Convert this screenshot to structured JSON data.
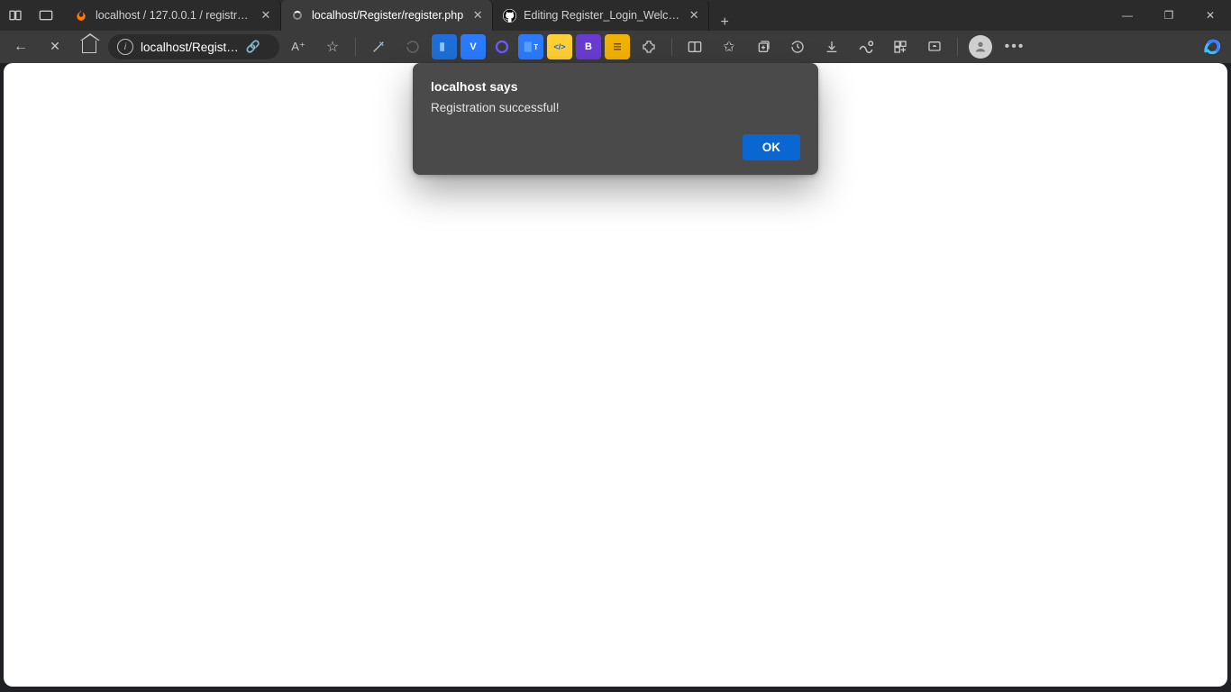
{
  "tabs": [
    {
      "title": "localhost / 127.0.0.1 / registratio",
      "favicon": "flame-icon"
    },
    {
      "title": "localhost/Register/register.php",
      "favicon": "loading-icon"
    },
    {
      "title": "Editing Register_Login_Welcome",
      "favicon": "github-icon"
    }
  ],
  "addressbar": {
    "url": "localhost/Regist…"
  },
  "dialog": {
    "title": "localhost says",
    "message": "Registration successful!",
    "ok_label": "OK"
  },
  "window_controls": {
    "minimize": "—",
    "maximize": "❐",
    "close": "✕"
  },
  "newtab_label": "+"
}
